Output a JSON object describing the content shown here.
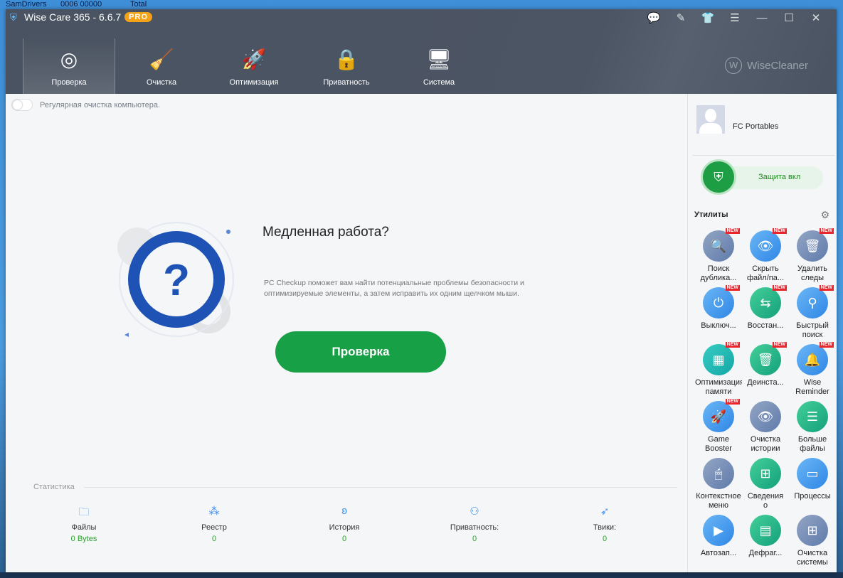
{
  "desktop": {
    "top_texts": [
      "SamDrivers",
      "0006 00000",
      "Total"
    ]
  },
  "app": {
    "title": "Wise Care 365 - 6.6.7",
    "badge": "PRO",
    "brand": "WiseCleaner"
  },
  "tabs": [
    {
      "label": "Проверка",
      "icon": "radar-icon"
    },
    {
      "label": "Очистка",
      "icon": "broom-icon"
    },
    {
      "label": "Оптимизация",
      "icon": "rocket-icon"
    },
    {
      "label": "Приватность",
      "icon": "shield-lock-icon"
    },
    {
      "label": "Система",
      "icon": "monitor-icon"
    }
  ],
  "main": {
    "toggle_label": "Регулярная очистка компьютера.",
    "heading": "Медленная работа?",
    "description": "PC Checkup поможет вам найти потенциальные проблемы безопасности и оптимизируемые элементы, а затем исправить их одним щелчком мыши.",
    "button": "Проверка",
    "hero_glyph": "?"
  },
  "stats": {
    "title": "Статистика",
    "items": [
      {
        "label": "Файлы",
        "value": "0 Bytes",
        "icon": "folder-icon"
      },
      {
        "label": "Реестр",
        "value": "0",
        "icon": "registry-icon"
      },
      {
        "label": "История",
        "value": "0",
        "icon": "footprint-icon"
      },
      {
        "label": "Приватность:",
        "value": "0",
        "icon": "user-lock-icon"
      },
      {
        "label": "Твики:",
        "value": "0",
        "icon": "rocket-icon"
      }
    ]
  },
  "sidebar": {
    "username": "FC Portables",
    "protection": "Защита вкл",
    "utilities_title": "Утилиты",
    "new_badge": "NEW",
    "utilities": [
      {
        "l1": "Поиск",
        "l2": "дублика...",
        "color": "gray",
        "glyph": "🔍",
        "new": true
      },
      {
        "l1": "Скрыть",
        "l2": "файл/па...",
        "color": "blue",
        "glyph": "👁",
        "new": true
      },
      {
        "l1": "Удалить",
        "l2": "следы",
        "color": "gray",
        "glyph": "🗑",
        "new": true
      },
      {
        "l1": "Выключ...",
        "l2": "",
        "color": "blue",
        "glyph": "⏻",
        "new": true
      },
      {
        "l1": "Восстан...",
        "l2": "",
        "color": "green",
        "glyph": "⇆",
        "new": true
      },
      {
        "l1": "Быстрый",
        "l2": "поиск",
        "color": "blue",
        "glyph": "⚲",
        "new": true
      },
      {
        "l1": "Оптимизация",
        "l2": "памяти",
        "color": "teal",
        "glyph": "▦",
        "new": true
      },
      {
        "l1": "Деинста...",
        "l2": "",
        "color": "green",
        "glyph": "🗑",
        "new": true
      },
      {
        "l1": "Wise",
        "l2": "Reminder",
        "color": "blue",
        "glyph": "🔔",
        "new": true
      },
      {
        "l1": "Game",
        "l2": "Booster",
        "color": "blue",
        "glyph": "🚀",
        "new": true
      },
      {
        "l1": "Очистка",
        "l2": "истории",
        "color": "gray",
        "glyph": "👁",
        "new": false
      },
      {
        "l1": "Больше",
        "l2": "файлы",
        "color": "green",
        "glyph": "☰",
        "new": false
      },
      {
        "l1": "Контекстное",
        "l2": "меню",
        "color": "gray",
        "glyph": "🖱",
        "new": false
      },
      {
        "l1": "Сведения",
        "l2": "о",
        "color": "green",
        "glyph": "⊞",
        "new": false
      },
      {
        "l1": "Процессы",
        "l2": "",
        "color": "blue",
        "glyph": "▭",
        "new": false
      },
      {
        "l1": "Автозап...",
        "l2": "",
        "color": "blue",
        "glyph": "▶",
        "new": false
      },
      {
        "l1": "Дефраг...",
        "l2": "",
        "color": "green",
        "glyph": "▤",
        "new": false
      },
      {
        "l1": "Очистка",
        "l2": "системы",
        "color": "gray",
        "glyph": "⊞",
        "new": false
      }
    ]
  }
}
